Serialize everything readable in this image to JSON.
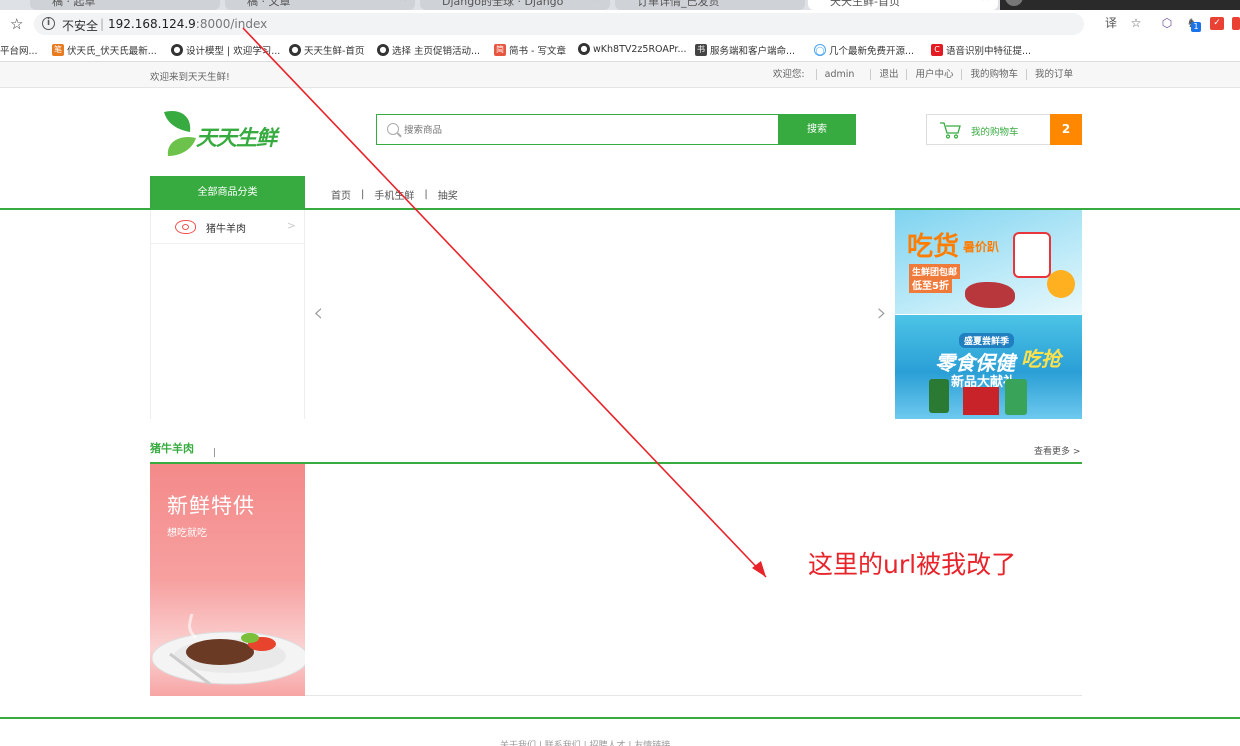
{
  "browser": {
    "tabs": [
      {
        "title": "稿 · 起草"
      },
      {
        "title": "稿 · 文章"
      },
      {
        "title": "Django的全球 · Django"
      },
      {
        "title": "订单详情_已发货"
      },
      {
        "title": "天天生鲜-首页"
      }
    ],
    "security_label": "不安全",
    "url_host": "192.168.124.9",
    "url_path": ":8000/index",
    "bookmarks": [
      {
        "label": "平台网..."
      },
      {
        "label": "伏天氏_伏天氏最新..."
      },
      {
        "label": "设计模型 | 欢迎学习..."
      },
      {
        "label": "天天生鲜-首页"
      },
      {
        "label": "选择 主页促销活动..."
      },
      {
        "label": "简书 - 写文章"
      },
      {
        "label": "wKh8TV2z5ROAPr..."
      },
      {
        "label": "服务端和客户端命..."
      },
      {
        "label": "几个最新免费开源..."
      },
      {
        "label": "语音识别中特征提..."
      }
    ],
    "ext_badge_count": "1"
  },
  "site": {
    "welcome": "欢迎来到天天生鲜!",
    "greeting": "欢迎您:",
    "username": "admin",
    "user_links": [
      "退出",
      "用户中心",
      "我的购物车",
      "我的订单"
    ],
    "logo_text": "天天生鲜",
    "search_placeholder": "搜索商品",
    "search_button": "搜索",
    "cart_label": "我的购物车",
    "cart_count": "2",
    "all_categories": "全部商品分类",
    "nav": [
      "首页",
      "手机生鲜",
      "抽奖"
    ],
    "side_menu": [
      {
        "label": "猪牛羊肉"
      }
    ],
    "ad1": {
      "line1": "吃货",
      "line2": "暑价趴",
      "line3": "生鲜团包邮",
      "line4": "低至5折"
    },
    "ad2": {
      "line1": "盛夏尝鲜季",
      "line2": "零食保健",
      "line3": "吃抢",
      "line4": "新品大献礼"
    },
    "floor_title": "猪牛羊肉",
    "floor_more": "查看更多 >",
    "promo_title": "新鲜特供",
    "promo_sub": "想吃就吃",
    "footer": "关于我们 | 联系我们 | 招聘人才 | 友情链接"
  },
  "annotation": {
    "text": "这里的url被我改了",
    "color": "#e8232a"
  },
  "colors": {
    "brand_green": "#37ab40",
    "cart_orange": "#ff8800"
  }
}
